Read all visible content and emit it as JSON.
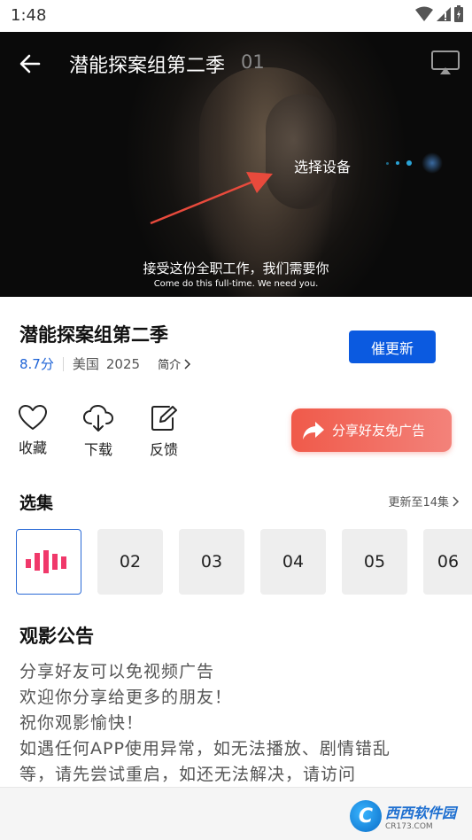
{
  "status": {
    "time": "1:48"
  },
  "player": {
    "title": "潜能探案组第二季",
    "episode": "01",
    "cast_hint": "选择设备",
    "subtitle_cn": "接受这份全职工作，我们需要你",
    "subtitle_en": "Come do this full-time. We need you."
  },
  "show": {
    "title": "潜能探案组第二季",
    "score": "8.7分",
    "region": "美国",
    "year": "2025",
    "intro_label": "简介",
    "urge_button": "催更新"
  },
  "actions": [
    {
      "label": "收藏",
      "icon": "heart-icon"
    },
    {
      "label": "下载",
      "icon": "download-cloud-icon"
    },
    {
      "label": "反馈",
      "icon": "feedback-edit-icon"
    }
  ],
  "share_button": "分享好友免广告",
  "episodes": {
    "heading": "选集",
    "updated": "更新至14集",
    "items": [
      "02",
      "03",
      "04",
      "05",
      "06"
    ]
  },
  "notice": {
    "heading": "观影公告",
    "lines": [
      "分享好友可以免视频广告",
      "欢迎你分享给更多的朋友！",
      "祝你观影愉快！",
      "如遇任何APP使用异常，如无法播放、剧情错乱",
      "等，请先尝试重启，如还无法解决，请访问"
    ]
  },
  "watermark": {
    "main": "西西软件园",
    "sub": "CR173.COM",
    "logo": "C"
  },
  "colors": {
    "accent": "#0b5ae0",
    "score": "#1e63d6",
    "share": "#f05a4a",
    "playing": "#f0386a"
  }
}
